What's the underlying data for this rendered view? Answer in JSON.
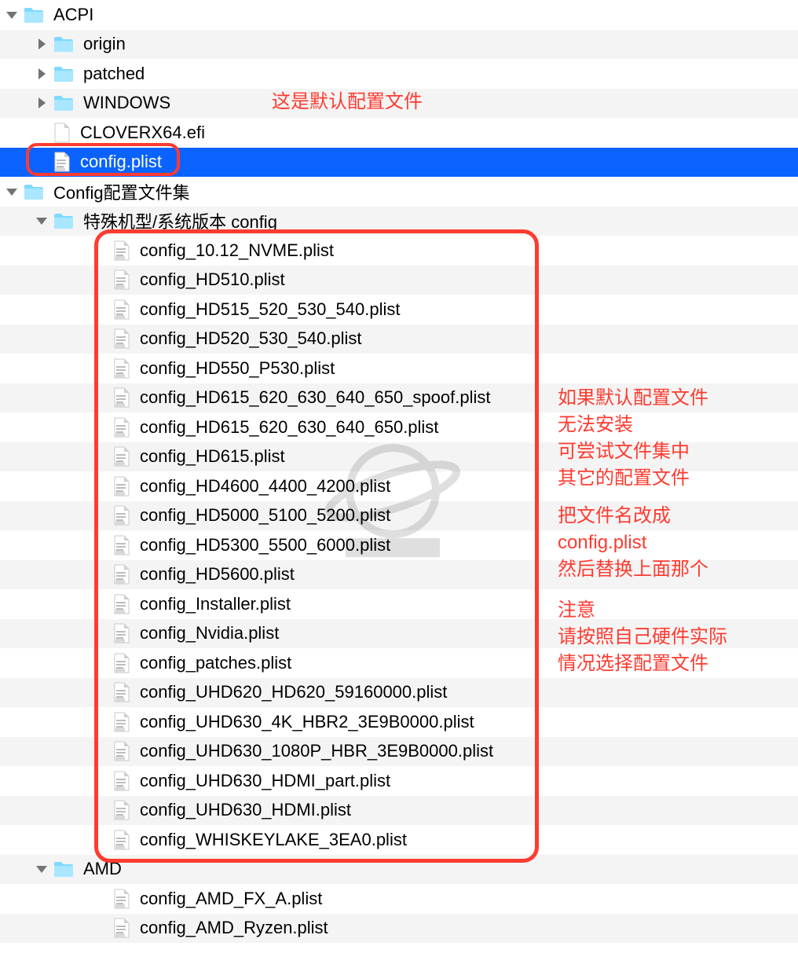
{
  "rows": [
    {
      "indent": 0,
      "type": "folder",
      "tri": "down",
      "label": "ACPI",
      "selected": false
    },
    {
      "indent": 1,
      "type": "folder",
      "tri": "right",
      "label": "origin",
      "selected": false
    },
    {
      "indent": 1,
      "type": "folder",
      "tri": "right",
      "label": "patched",
      "selected": false
    },
    {
      "indent": 1,
      "type": "folder",
      "tri": "right",
      "label": "WINDOWS",
      "selected": false
    },
    {
      "indent": 1,
      "type": "efi",
      "tri": "",
      "label": "CLOVERX64.efi",
      "selected": false
    },
    {
      "indent": 1,
      "type": "plist",
      "tri": "",
      "label": "config.plist",
      "selected": true
    },
    {
      "indent": 0,
      "type": "folder",
      "tri": "down",
      "label": "Config配置文件集",
      "selected": false
    },
    {
      "indent": 1,
      "type": "folder",
      "tri": "down",
      "label": "特殊机型/系统版本 config",
      "selected": false
    },
    {
      "indent": 3,
      "type": "plist",
      "tri": "",
      "label": "config_10.12_NVME.plist",
      "selected": false
    },
    {
      "indent": 3,
      "type": "plist",
      "tri": "",
      "label": "config_HD510.plist",
      "selected": false
    },
    {
      "indent": 3,
      "type": "plist",
      "tri": "",
      "label": "config_HD515_520_530_540.plist",
      "selected": false
    },
    {
      "indent": 3,
      "type": "plist",
      "tri": "",
      "label": "config_HD520_530_540.plist",
      "selected": false
    },
    {
      "indent": 3,
      "type": "plist",
      "tri": "",
      "label": "config_HD550_P530.plist",
      "selected": false
    },
    {
      "indent": 3,
      "type": "plist",
      "tri": "",
      "label": "config_HD615_620_630_640_650_spoof.plist",
      "selected": false
    },
    {
      "indent": 3,
      "type": "plist",
      "tri": "",
      "label": "config_HD615_620_630_640_650.plist",
      "selected": false
    },
    {
      "indent": 3,
      "type": "plist",
      "tri": "",
      "label": "config_HD615.plist",
      "selected": false
    },
    {
      "indent": 3,
      "type": "plist",
      "tri": "",
      "label": "config_HD4600_4400_4200.plist",
      "selected": false
    },
    {
      "indent": 3,
      "type": "plist",
      "tri": "",
      "label": "config_HD5000_5100_5200.plist",
      "selected": false
    },
    {
      "indent": 3,
      "type": "plist",
      "tri": "",
      "label": "config_HD5300_5500_6000.plist",
      "selected": false
    },
    {
      "indent": 3,
      "type": "plist",
      "tri": "",
      "label": "config_HD5600.plist",
      "selected": false
    },
    {
      "indent": 3,
      "type": "plist",
      "tri": "",
      "label": "config_Installer.plist",
      "selected": false
    },
    {
      "indent": 3,
      "type": "plist",
      "tri": "",
      "label": "config_Nvidia.plist",
      "selected": false
    },
    {
      "indent": 3,
      "type": "plist",
      "tri": "",
      "label": "config_patches.plist",
      "selected": false
    },
    {
      "indent": 3,
      "type": "plist",
      "tri": "",
      "label": "config_UHD620_HD620_59160000.plist",
      "selected": false
    },
    {
      "indent": 3,
      "type": "plist",
      "tri": "",
      "label": "config_UHD630_4K_HBR2_3E9B0000.plist",
      "selected": false
    },
    {
      "indent": 3,
      "type": "plist",
      "tri": "",
      "label": "config_UHD630_1080P_HBR_3E9B0000.plist",
      "selected": false
    },
    {
      "indent": 3,
      "type": "plist",
      "tri": "",
      "label": "config_UHD630_HDMI_part.plist",
      "selected": false
    },
    {
      "indent": 3,
      "type": "plist",
      "tri": "",
      "label": "config_UHD630_HDMI.plist",
      "selected": false
    },
    {
      "indent": 3,
      "type": "plist",
      "tri": "",
      "label": "config_WHISKEYLAKE_3EA0.plist",
      "selected": false
    },
    {
      "indent": 1,
      "type": "folder",
      "tri": "down",
      "label": "AMD",
      "selected": false
    },
    {
      "indent": 3,
      "type": "plist",
      "tri": "",
      "label": "config_AMD_FX_A.plist",
      "selected": false
    },
    {
      "indent": 3,
      "type": "plist",
      "tri": "",
      "label": "config_AMD_Ryzen.plist",
      "selected": false
    }
  ],
  "annotations": {
    "a1": "这是默认配置文件",
    "a2": "如果默认配置文件\n无法安装\n可尝试文件集中\n其它的配置文件",
    "a3": "把文件名改成\nconfig.plist\n然后替换上面那个",
    "a4": "注意\n请按照自己硬件实际\n情况选择配置文件"
  }
}
